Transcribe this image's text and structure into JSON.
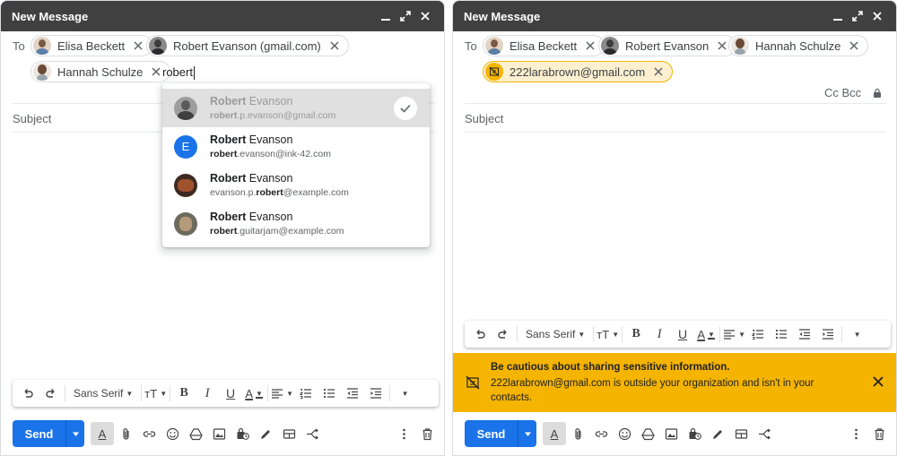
{
  "left": {
    "title": "New Message",
    "to_label": "To",
    "recipients": [
      {
        "name": "Elisa Beckett"
      },
      {
        "name": "Robert Evanson (gmail.com)"
      },
      {
        "name": "Hannah Schulze"
      }
    ],
    "typed": "robert",
    "subject_placeholder": "Subject",
    "suggestions": [
      {
        "name_bold": "Robert",
        "name_rest": " Evanson",
        "email_bold": "robert",
        "email_rest": ".p.evanson@gmail.com",
        "selected": true
      },
      {
        "name_bold": "Robert",
        "name_rest": " Evanson",
        "email_bold": "robert",
        "email_rest": ".evanson@ink-42.com",
        "avatar_letter": "E"
      },
      {
        "name_bold": "Robert",
        "name_rest": " Evanson",
        "email_pre": "evanson.p.",
        "email_bold": "robert",
        "email_rest": "@example.com"
      },
      {
        "name_bold": "Robert",
        "name_rest": " Evanson",
        "email_bold": "robert",
        "email_rest": ".guitarjam@example.com"
      }
    ]
  },
  "right": {
    "title": "New Message",
    "to_label": "To",
    "recipients": [
      {
        "name": "Elisa Beckett"
      },
      {
        "name": "Robert Evanson"
      },
      {
        "name": "Hannah Schulze"
      },
      {
        "name": "222larabrown@gmail.com",
        "external": true
      }
    ],
    "ccbcc": "Cc Bcc",
    "subject_placeholder": "Subject",
    "warning": {
      "title": "Be cautious about sharing sensitive information.",
      "body": "222larabrown@gmail.com is outside your organization and isn't in your contacts."
    }
  },
  "toolbar": {
    "font": "Sans Serif"
  },
  "send_label": "Send",
  "colors": {
    "titlebar": "#404040",
    "send": "#1a73e8",
    "warning": "#f5b400",
    "chip_warning": "#fdf0d0"
  }
}
